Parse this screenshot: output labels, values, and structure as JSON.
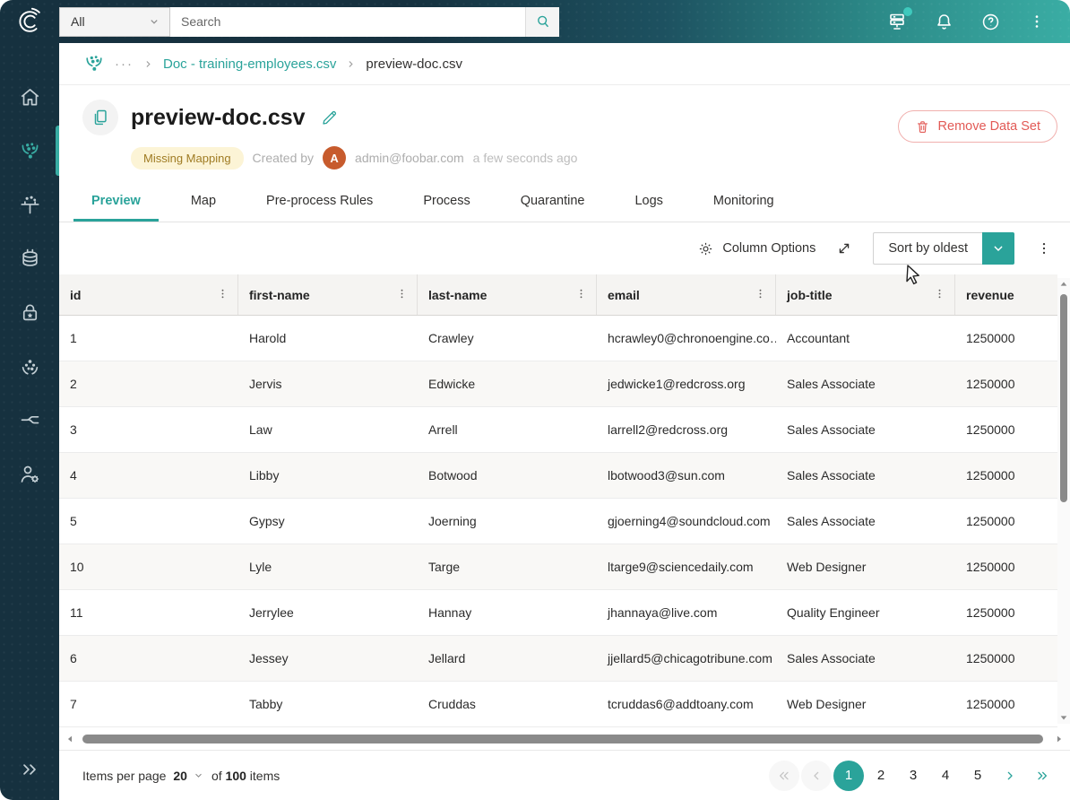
{
  "colors": {
    "navy": "#16313f",
    "accent_teal": "#2aa39a",
    "badge_bg": "#fcf4d6",
    "badge_text": "#9f7b23",
    "avatar_bg": "#c75b2d",
    "remove_red": "#e25a56"
  },
  "topbar": {
    "scope": "All",
    "search_placeholder": "Search",
    "icons": [
      "server-status-icon",
      "bell-icon",
      "help-icon",
      "more-menu-icon"
    ]
  },
  "sidebar": {
    "items": [
      "home-icon",
      "data-sources-icon",
      "enrichment-icon",
      "data-catalog-icon",
      "governance-icon",
      "management-icon",
      "streams-icon",
      "administration-icon"
    ],
    "expand": "expand-icon",
    "active_item": "data-sources-icon"
  },
  "breadcrumb": {
    "ellipsis": "···",
    "parent": "Doc - training-employees.csv",
    "current": "preview-doc.csv"
  },
  "header": {
    "title": "preview-doc.csv",
    "badge": "Missing Mapping",
    "created_by_label": "Created by",
    "avatar_initial": "A",
    "creator": "admin@foobar.com",
    "created_time": "a few seconds ago",
    "remove_button": "Remove Data Set"
  },
  "tabs": [
    "Preview",
    "Map",
    "Pre-process Rules",
    "Process",
    "Quarantine",
    "Logs",
    "Monitoring"
  ],
  "active_tab": "Preview",
  "toolbar": {
    "column_options_label": "Column Options",
    "sort_label": "Sort by oldest"
  },
  "table": {
    "columns": [
      "id",
      "first-name",
      "last-name",
      "email",
      "job-title",
      "revenue"
    ],
    "rows": [
      [
        "1",
        "Harold",
        "Crawley",
        "hcrawley0@chronoengine.co…",
        "Accountant",
        "1250000"
      ],
      [
        "2",
        "Jervis",
        "Edwicke",
        "jedwicke1@redcross.org",
        "Sales Associate",
        "1250000"
      ],
      [
        "3",
        "Law",
        "Arrell",
        "larrell2@redcross.org",
        "Sales Associate",
        "1250000"
      ],
      [
        "4",
        "Libby",
        "Botwood",
        "lbotwood3@sun.com",
        "Sales Associate",
        "1250000"
      ],
      [
        "5",
        "Gypsy",
        "Joerning",
        "gjoerning4@soundcloud.com",
        "Sales Associate",
        "1250000"
      ],
      [
        "10",
        "Lyle",
        "Targe",
        "ltarge9@sciencedaily.com",
        "Web Designer",
        "1250000"
      ],
      [
        "11",
        "Jerrylee",
        "Hannay",
        "jhannaya@live.com",
        "Quality Engineer",
        "1250000"
      ],
      [
        "6",
        "Jessey",
        "Jellard",
        "jjellard5@chicagotribune.com",
        "Sales Associate",
        "1250000"
      ],
      [
        "7",
        "Tabby",
        "Cruddas",
        "tcruddas6@addtoany.com",
        "Web Designer",
        "1250000"
      ]
    ]
  },
  "pagination": {
    "items_per_page_label": "Items per page",
    "items_per_page_value": "20",
    "of_label": "of",
    "total_items": "100",
    "items_label": "items",
    "pages": [
      "1",
      "2",
      "3",
      "4",
      "5"
    ],
    "current_page": "1"
  }
}
